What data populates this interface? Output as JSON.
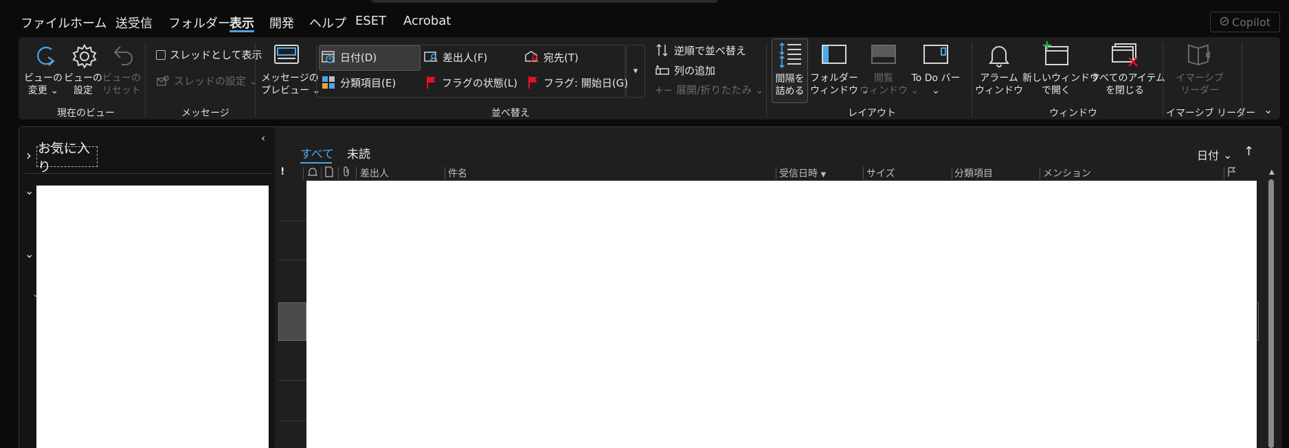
{
  "menu": {
    "items": [
      {
        "label": "ファイル"
      },
      {
        "label": "ホーム"
      },
      {
        "label": "送受信"
      },
      {
        "label": "フォルダー"
      },
      {
        "label": "表示",
        "active": true
      },
      {
        "label": "開発"
      },
      {
        "label": "ヘルプ"
      },
      {
        "label": "ESET"
      },
      {
        "label": "Acrobat"
      }
    ],
    "copilot": "Copilot"
  },
  "ribbon": {
    "current_view": {
      "change_view": "ビューの\n変更 ⌄",
      "view_settings": "ビューの\n設定",
      "reset_view": "ビューの\nリセット",
      "group_label": "現在のビュー"
    },
    "messages": {
      "show_as_threads": "スレッドとして表示",
      "thread_settings": "スレッドの設定 ⌄",
      "group_label": "メッセージ"
    },
    "arrangement": {
      "message_preview": "メッセージの\nプレビュー ⌄",
      "date": "日付(D)",
      "from": "差出人(F)",
      "to": "宛先(T)",
      "categories": "分類項目(E)",
      "flag_status": "フラグの状態(L)",
      "flag_start": "フラグ: 開始日(G)",
      "reverse_sort": "逆順で並べ替え",
      "add_columns": "列の追加",
      "expand_collapse": "展開/折りたたみ ⌄",
      "group_label": "並べ替え"
    },
    "layout": {
      "reduce_spacing": "間隔を\n詰める",
      "folder_pane": "フォルダー\nウィンドウ ⌄",
      "reading_pane": "閲覧\nウィンドウ ⌄",
      "todo_bar": "To Do バー\n⌄",
      "group_label": "レイアウト"
    },
    "window": {
      "reminders": "アラーム\nウィンドウ",
      "open_new_window": "新しいウィンドウ\nで開く",
      "close_all_items": "すべてのアイテム\nを閉じる",
      "group_label": "ウィンドウ"
    },
    "immersive": {
      "reader": "イマーシブ\nリーダー",
      "group_label": "イマーシブ リーダー"
    }
  },
  "folder_pane": {
    "favorites": "お気に入り"
  },
  "message_list": {
    "tabs": [
      {
        "label": "すべて",
        "active": true
      },
      {
        "label": "未読"
      }
    ],
    "sort_by": "日付",
    "columns": {
      "importance": "!",
      "from": "差出人",
      "subject": "件名",
      "received": "受信日時",
      "size": "サイズ",
      "categories": "分類項目",
      "mention": "メンション"
    }
  },
  "colors": {
    "accent": "#4aa8e8",
    "flag_red": "#e81123",
    "background": "#0b0b0b",
    "panel": "#1f1f1f"
  }
}
